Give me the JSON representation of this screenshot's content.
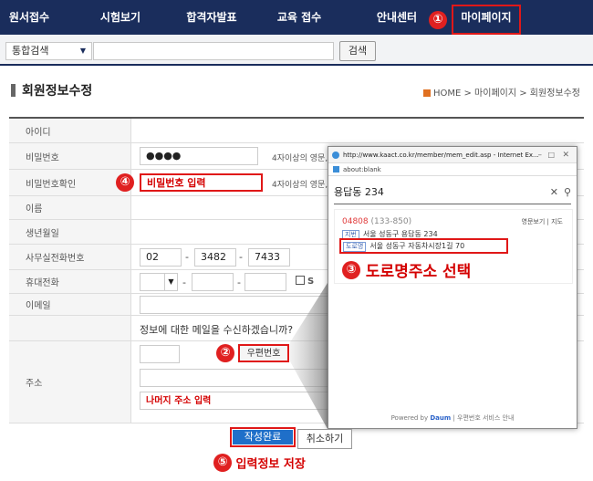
{
  "nav": {
    "items": [
      "원서접수",
      "시험보기",
      "합격자발표",
      "교육 접수",
      "안내센터",
      "마이페이지"
    ]
  },
  "steps": [
    "①",
    "②",
    "③",
    "④",
    "⑤"
  ],
  "search": {
    "scope": "통합검색",
    "button": "검색"
  },
  "page": {
    "title": "회원정보수정",
    "breadcrumb": "HOME  >  마이페이지  >  회원정보수정"
  },
  "form": {
    "labels": [
      "아이디",
      "비밀번호",
      "비밀번호확인",
      "이름",
      "생년월일",
      "사무실전화번호",
      "휴대전화",
      "이메일",
      "",
      "주소"
    ],
    "password_value": "●●●●",
    "password_note": "4자이상의 영문,",
    "password_confirm_note": "4자이상의 영문,",
    "password_confirm_callout": "비밀번호 입력",
    "office_phone": [
      "02",
      "3482",
      "7433"
    ],
    "mobile_sms": "S",
    "email_question": "정보에 대한 메일을 수신하겠습니까?",
    "zipcode_button": "우편번호",
    "address_callout": "나머지 주소 입력"
  },
  "popup": {
    "window_title": "http://www.kaact.co.kr/member/mem_edit.asp - Internet Ex...",
    "address_bar": "about:blank",
    "search_text": "용답동 234",
    "zipcode": "04808",
    "old_zipcode": "(133-850)",
    "actions": "영문보기  |  지도",
    "jibun_tag": "지번",
    "jibun_addr": "서울 성동구 용답동 234",
    "road_tag": "도로명",
    "road_addr": "서울 성동구 자동차시장1길 70",
    "footer_powered": "Powered by",
    "footer_brand": "Daum",
    "footer_service": "|  우편번호 서비스 안내",
    "callout": "도로명주소 선택"
  },
  "buttons": {
    "submit": "작성완료",
    "cancel": "취소하기",
    "submit_callout": "입력정보 저장"
  },
  "colors": {
    "nav_bg": "#1a2d5c",
    "highlight_red": "#e01818",
    "submit_blue": "#1f6fc9"
  }
}
